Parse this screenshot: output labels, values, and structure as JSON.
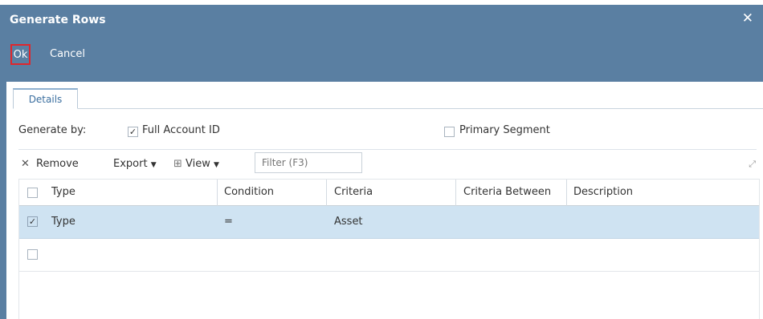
{
  "dialog": {
    "title": "Generate Rows",
    "close_icon": "close-icon"
  },
  "toolbar": {
    "ok_label": "Ok",
    "cancel_label": "Cancel"
  },
  "tabs": [
    {
      "label": "Details",
      "active": true
    }
  ],
  "generate_by": {
    "label": "Generate by:",
    "options": [
      {
        "label": "Full Account ID",
        "checked": true
      },
      {
        "label": "Primary Segment",
        "checked": false
      }
    ]
  },
  "grid_toolbar": {
    "remove_label": "Remove",
    "export_label": "Export",
    "view_label": "View",
    "filter_placeholder": "Filter (F3)"
  },
  "grid": {
    "columns": [
      "Type",
      "Condition",
      "Criteria",
      "Criteria Between",
      "Description"
    ],
    "rows": [
      {
        "checked": true,
        "type": "Type",
        "condition": "=",
        "criteria": "Asset",
        "criteria_between": "",
        "description": ""
      },
      {
        "checked": false,
        "type": "",
        "condition": "",
        "criteria": "",
        "criteria_between": "",
        "description": ""
      }
    ]
  },
  "colors": {
    "header_bg": "#5a7fa2",
    "selected_row_bg": "#cfe3f2",
    "ok_highlight": "#e0262c"
  }
}
